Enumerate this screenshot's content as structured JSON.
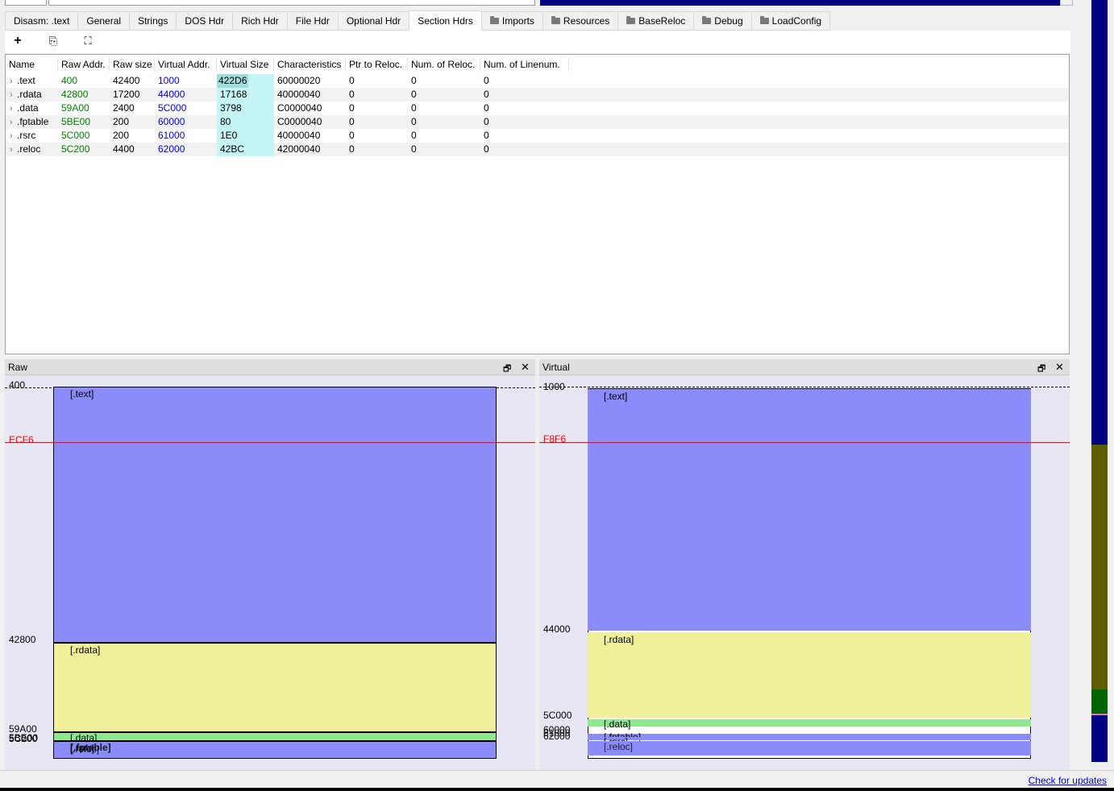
{
  "tabs": [
    {
      "label": "Disasm: .text",
      "folder": false,
      "active": false
    },
    {
      "label": "General",
      "folder": false,
      "active": false
    },
    {
      "label": "Strings",
      "folder": false,
      "active": false
    },
    {
      "label": "DOS Hdr",
      "folder": false,
      "active": false
    },
    {
      "label": "Rich Hdr",
      "folder": false,
      "active": false
    },
    {
      "label": "File Hdr",
      "folder": false,
      "active": false
    },
    {
      "label": "Optional Hdr",
      "folder": false,
      "active": false
    },
    {
      "label": "Section Hdrs",
      "folder": false,
      "active": true
    },
    {
      "label": "Imports",
      "folder": true,
      "active": false
    },
    {
      "label": "Resources",
      "folder": true,
      "active": false
    },
    {
      "label": "BaseReloc",
      "folder": true,
      "active": false
    },
    {
      "label": "Debug",
      "folder": true,
      "active": false
    },
    {
      "label": "LoadConfig",
      "folder": true,
      "active": false
    }
  ],
  "toolbar": {
    "add_icon": "plus-icon",
    "add_glyph": "+",
    "copy_icon": "copy-structure-icon",
    "copy_glyph": "⎘",
    "expand_icon": "expand-icon",
    "expand_glyph": "⛶"
  },
  "table": {
    "columns": [
      "Name",
      "Raw Addr.",
      "Raw size",
      "Virtual Addr.",
      "Virtual Size",
      "Characteristics",
      "Ptr to Reloc.",
      "Num. of Reloc.",
      "Num. of Linenum."
    ],
    "rows": [
      [
        ".text",
        "400",
        "42400",
        "1000",
        "422D6",
        "60000020",
        "0",
        "0",
        "0"
      ],
      [
        ".rdata",
        "42800",
        "17200",
        "44000",
        "17168",
        "40000040",
        "0",
        "0",
        "0"
      ],
      [
        ".data",
        "59A00",
        "2400",
        "5C000",
        "3798",
        "C0000040",
        "0",
        "0",
        "0"
      ],
      [
        ".fptable",
        "5BE00",
        "200",
        "60000",
        "80",
        "C0000040",
        "0",
        "0",
        "0"
      ],
      [
        ".rsrc",
        "5C000",
        "200",
        "61000",
        "1E0",
        "40000040",
        "0",
        "0",
        "0"
      ],
      [
        ".reloc",
        "5C200",
        "4400",
        "62000",
        "42BC",
        "42000040",
        "0",
        "0",
        "0"
      ]
    ],
    "expand_glyph": "›"
  },
  "raw_pane": {
    "title": "Raw",
    "float_glyph": "🗗",
    "close_glyph": "✕",
    "cursor_addr": "ECF6",
    "labels": {
      "top": "400",
      "rdata": "42800",
      "data": "59A00",
      "tail1": "5BE00",
      "tail2": "5C200",
      "tail3": "5C000"
    },
    "sections": {
      "text": "[.text]",
      "rdata": "[.rdata]",
      "data": "[.data]",
      "fptable": "[.fptable]",
      "rsrc": "[.rsrc]",
      "reloc": "[.reloc]"
    }
  },
  "virtual_pane": {
    "title": "Virtual",
    "float_glyph": "🗗",
    "close_glyph": "✕",
    "cursor_addr": "F8F6",
    "labels": {
      "top": "1000",
      "rdata": "44000",
      "data": "5C000",
      "fptable": "60000",
      "rsrc": "61000",
      "reloc": "62000"
    },
    "sections": {
      "text": "[.text]",
      "rdata": "[.rdata]",
      "data": "[.data]",
      "fptable": "[.fptable]",
      "rsrc": "[.rsrc]",
      "reloc": "[.reloc]"
    }
  },
  "status": {
    "check_updates": "Check for updates"
  },
  "colors": {
    "text_section": "#8b8bf9",
    "rdata_section": "#f0ef9a",
    "data_section": "#8ee88e",
    "cursor_line": "#ff0000",
    "link": "#0000ee"
  }
}
